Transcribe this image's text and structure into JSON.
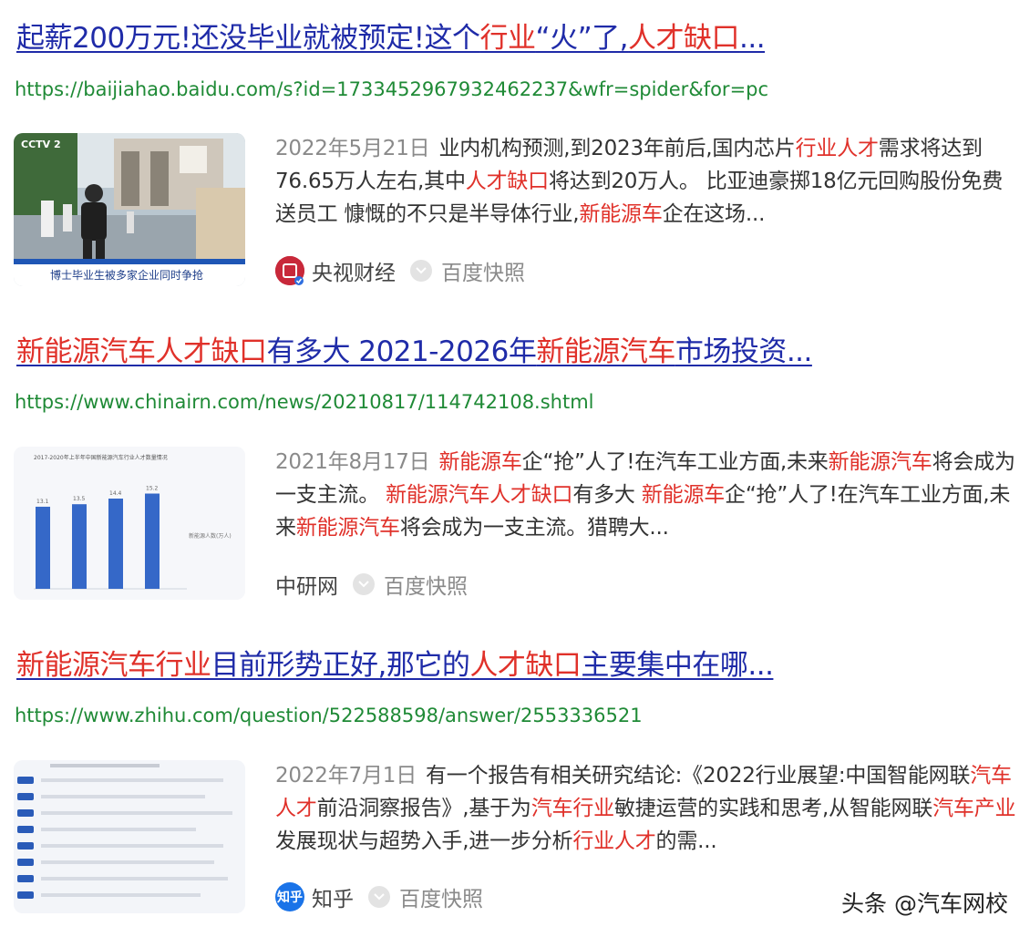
{
  "results": [
    {
      "title_parts": [
        {
          "text": "起薪200万元!还没毕业就被预定!这个",
          "em": false
        },
        {
          "text": "行业",
          "em": true
        },
        {
          "text": "“火”了,",
          "em": false
        },
        {
          "text": "人才缺口",
          "em": true
        },
        {
          "text": "...",
          "em": false
        }
      ],
      "url": "https://baijiahao.baidu.com/s?id=1733452967932462237&wfr=spider&for=pc",
      "thumbnail": {
        "caption": "博士毕业生被多家企业同时争抢",
        "logo_text": "CCTV 2"
      },
      "date": "2022年5月21日",
      "snippet_parts": [
        {
          "text": "业内机构预测,到2023年前后,国内芯片",
          "em": false
        },
        {
          "text": "行业人才",
          "em": true
        },
        {
          "text": "需求将达到76.65万人左右,其中",
          "em": false
        },
        {
          "text": "人才缺口",
          "em": true
        },
        {
          "text": "将达到20万人。 比亚迪豪掷18亿元回购股份免费送员工 慷慨的不只是半导体行业,",
          "em": false
        },
        {
          "text": "新能源车",
          "em": true
        },
        {
          "text": "企在这场...",
          "em": false
        }
      ],
      "source": "央视财经",
      "source_logo_color": "#c8283a",
      "snapshot": "百度快照"
    },
    {
      "title_parts": [
        {
          "text": "新能源汽车人才缺口",
          "em": true
        },
        {
          "text": "有多大 2021-2026年",
          "em": false
        },
        {
          "text": "新能源汽车",
          "em": true
        },
        {
          "text": "市场投资...",
          "em": false
        }
      ],
      "url": "https://www.chinairn.com/news/20210817/114742108.shtml",
      "thumbnail": {
        "chart_title": "2017-2020年上半年中国新能源汽车行业人才数量情况",
        "legend": "新能源人数(万人)",
        "bars": [
          13.1,
          13.5,
          14.4,
          15.2
        ]
      },
      "date": "2021年8月17日",
      "snippet_parts": [
        {
          "text": "新能源车",
          "em": true
        },
        {
          "text": "企“抢”人了!在汽车工业方面,未来",
          "em": false
        },
        {
          "text": "新能源汽车",
          "em": true
        },
        {
          "text": "将会成为一支主流。 ",
          "em": false
        },
        {
          "text": "新能源汽车人才缺口",
          "em": true
        },
        {
          "text": "有多大 ",
          "em": false
        },
        {
          "text": "新能源车",
          "em": true
        },
        {
          "text": "企“抢”人了!在汽车工业方面,未来",
          "em": false
        },
        {
          "text": "新能源汽车",
          "em": true
        },
        {
          "text": "将会成为一支主流。猎聘大...",
          "em": false
        }
      ],
      "source": "中研网",
      "snapshot": "百度快照"
    },
    {
      "title_parts": [
        {
          "text": "新能源汽车行业",
          "em": true
        },
        {
          "text": "目前形势正好,那它的",
          "em": false
        },
        {
          "text": "人才缺口",
          "em": true
        },
        {
          "text": "主要集中在哪...",
          "em": false
        }
      ],
      "url": "https://www.zhihu.com/question/522588598/answer/2553336521",
      "date": "2022年7月1日",
      "snippet_parts": [
        {
          "text": "有一个报告有相关研究结论:《2022行业展望:中国智能网联",
          "em": false
        },
        {
          "text": "汽车人才",
          "em": true
        },
        {
          "text": "前沿洞察报告》,基于为",
          "em": false
        },
        {
          "text": "汽车行业",
          "em": true
        },
        {
          "text": "敏捷运营的实践和思考,从智能网联",
          "em": false
        },
        {
          "text": "汽车产业",
          "em": true
        },
        {
          "text": "发展现状与超势入手,进一步分析",
          "em": false
        },
        {
          "text": "行业人才",
          "em": true
        },
        {
          "text": "的需...",
          "em": false
        }
      ],
      "source": "知乎",
      "source_logo_text": "知乎",
      "source_logo_color": "#1a73e8",
      "snapshot": "百度快照"
    }
  ],
  "watermark": "头条 @汽车网校"
}
